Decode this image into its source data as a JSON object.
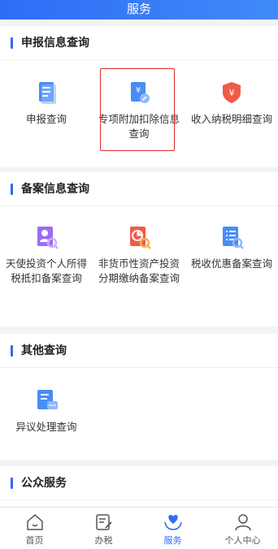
{
  "header": {
    "title": "服务"
  },
  "sections": [
    {
      "title": "申报信息查询",
      "items": [
        {
          "label": "申报查询",
          "icon": "document-list-icon"
        },
        {
          "label": "专项附加扣除信息查询",
          "icon": "yuan-document-icon"
        },
        {
          "label": "收入纳税明细查询",
          "icon": "yuan-shield-icon"
        }
      ]
    },
    {
      "title": "备案信息查询",
      "items": [
        {
          "label": "天使投资个人所得税抵扣备案查询",
          "icon": "person-search-icon"
        },
        {
          "label": "非货币性资产投资分期缴纳备案查询",
          "icon": "chart-search-icon"
        },
        {
          "label": "税收优惠备案查询",
          "icon": "list-search-icon"
        }
      ]
    },
    {
      "title": "其他查询",
      "items": [
        {
          "label": "异议处理查询",
          "icon": "chat-document-icon"
        }
      ]
    },
    {
      "title": "公众服务",
      "items": []
    }
  ],
  "tabbar": {
    "items": [
      {
        "label": "首页",
        "icon": "home-icon"
      },
      {
        "label": "办税",
        "icon": "edit-document-icon"
      },
      {
        "label": "服务",
        "icon": "heart-hands-icon",
        "active": true
      },
      {
        "label": "个人中心",
        "icon": "person-icon"
      }
    ]
  },
  "colors": {
    "accent": "#2f6cf6",
    "highlight": "#e02b2b"
  }
}
